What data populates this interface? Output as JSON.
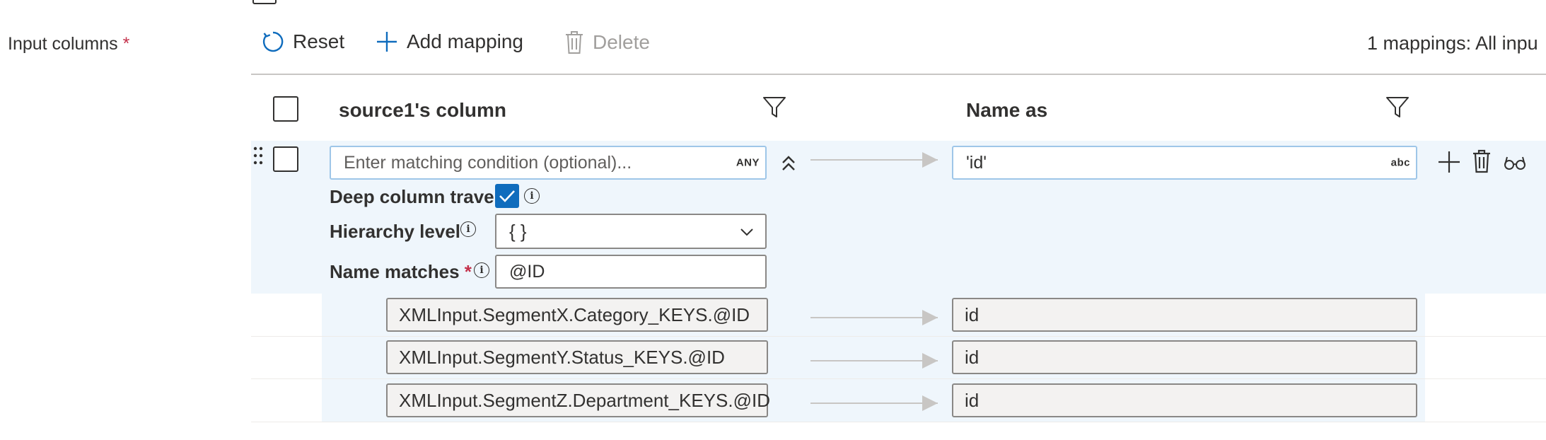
{
  "input_columns": {
    "label": "Input columns",
    "required_mark": "*"
  },
  "toolbar": {
    "reset_label": "Reset",
    "add_mapping_label": "Add mapping",
    "delete_label": "Delete",
    "mappings_summary": "1 mappings: All inpu"
  },
  "table": {
    "col_source_header": "source1's column",
    "col_name_header": "Name as"
  },
  "rule": {
    "condition_placeholder": "Enter matching condition (optional)...",
    "condition_type_badge": "ANY",
    "name_as_value": "'id'",
    "name_as_type_badge": "abc",
    "deep_traversal_label": "Deep column traver",
    "deep_traversal_checked": true,
    "hierarchy_label": "Hierarchy level",
    "hierarchy_value": "{ }",
    "name_matches_label": "Name matches",
    "name_matches_required": "*",
    "name_matches_value": "@ID"
  },
  "matches": [
    {
      "source": "XMLInput.SegmentX.Category_KEYS.@ID",
      "target": "id"
    },
    {
      "source": "XMLInput.SegmentY.Status_KEYS.@ID",
      "target": "id"
    },
    {
      "source": "XMLInput.SegmentZ.Department_KEYS.@ID",
      "target": "id"
    }
  ],
  "colors": {
    "accent": "#0f6cbd",
    "expanded_row_bg": "#eff6fc",
    "required": "#c4314b",
    "disabled_text": "#a19f9d"
  }
}
